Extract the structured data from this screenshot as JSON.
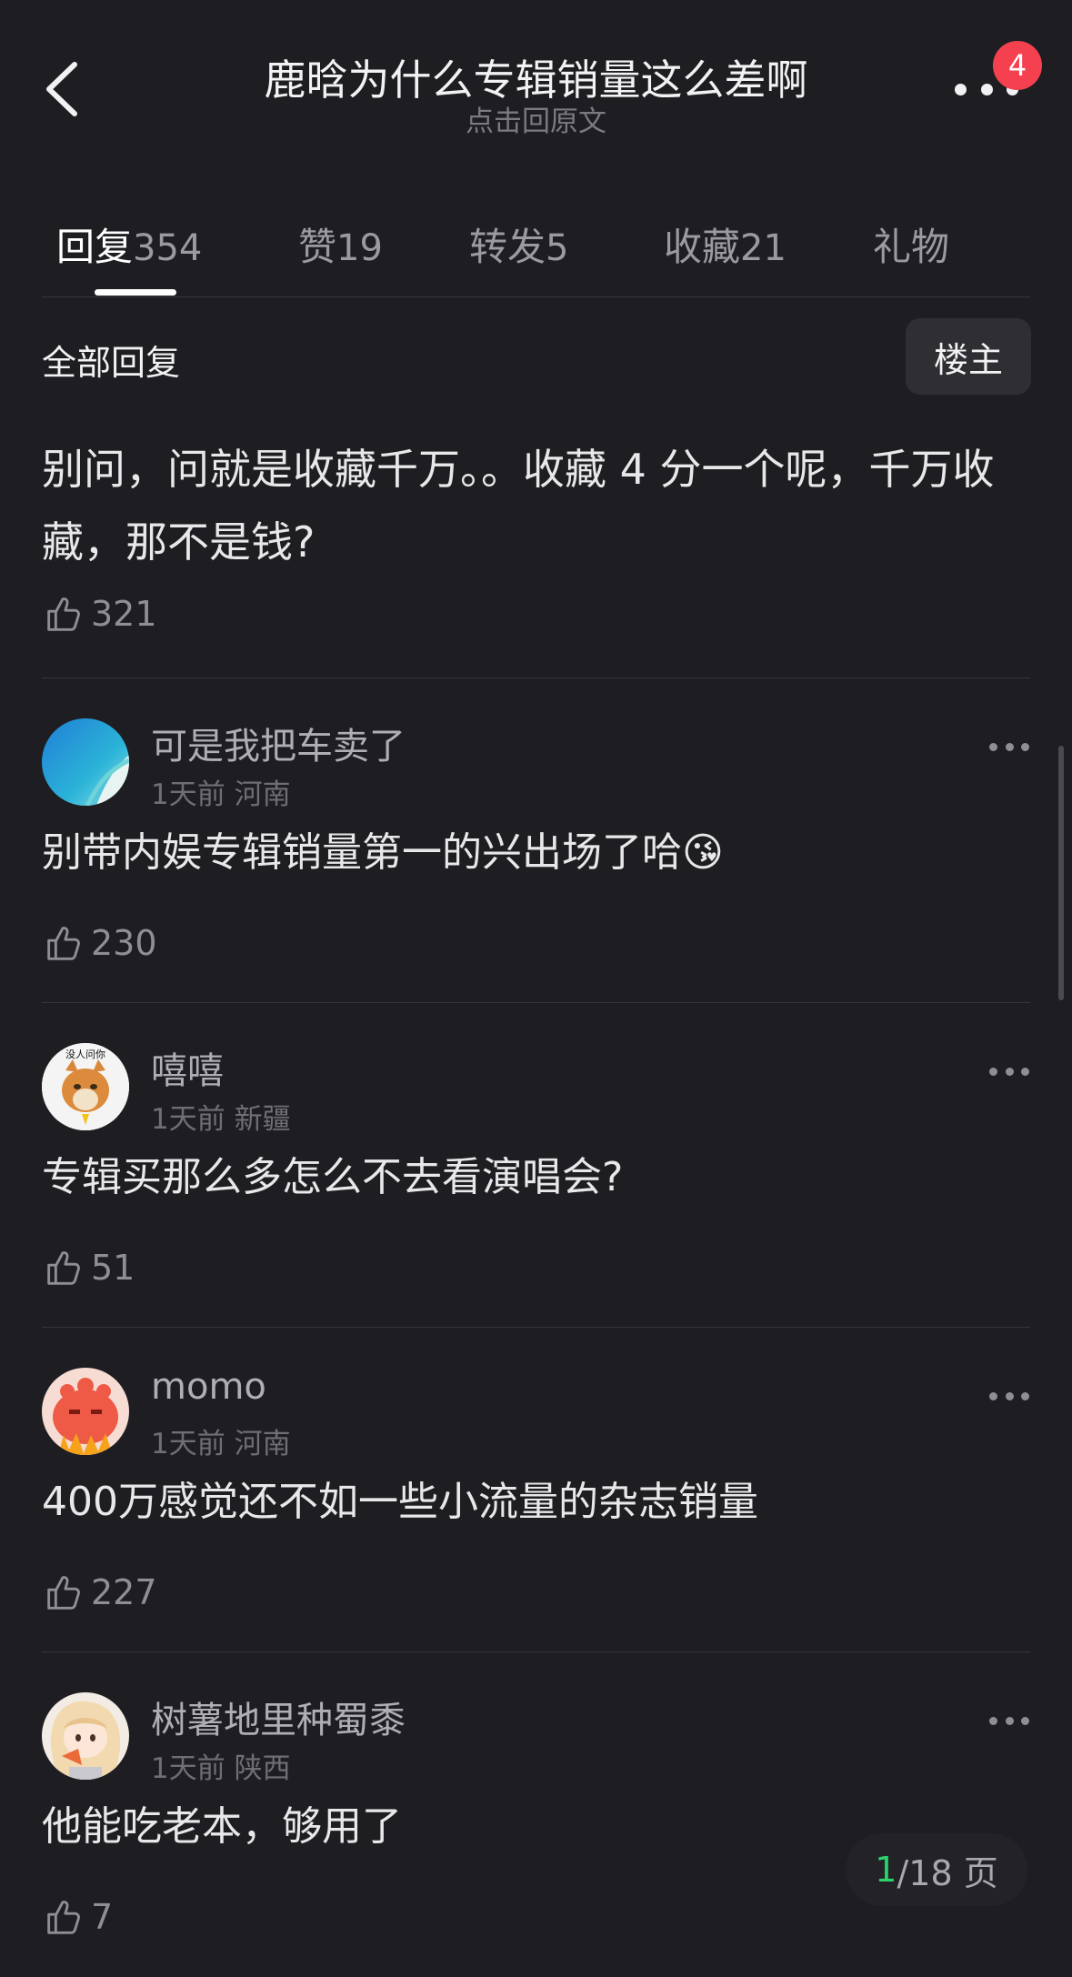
{
  "header": {
    "title": "鹿晗为什么专辑销量这么差啊",
    "subtitle": "点击回原文",
    "notification_count": "4"
  },
  "tabs": [
    {
      "label": "回复",
      "count": "354",
      "active": true
    },
    {
      "label": "赞",
      "count": "19"
    },
    {
      "label": "转发",
      "count": "5"
    },
    {
      "label": "收藏",
      "count": "21"
    },
    {
      "label": "礼物",
      "count": ""
    }
  ],
  "filter": {
    "label": "全部回复",
    "op_button": "楼主"
  },
  "op_post": {
    "text": "别问，问就是收藏千万。。收藏 4 分一个呢，千万收藏，那不是钱?",
    "likes": "321"
  },
  "comments": [
    {
      "username": "可是我把车卖了",
      "time": "1天前",
      "location": "河南",
      "text": "别带内娱专辑销量第一的兴出场了哈",
      "emoji": "😘",
      "likes": "230"
    },
    {
      "username": "嘻嘻",
      "time": "1天前",
      "location": "新疆",
      "text": "专辑买那么多怎么不去看演唱会?",
      "emoji": "",
      "likes": "51",
      "avatar_caption": "没人问你"
    },
    {
      "username": "momo",
      "time": "1天前",
      "location": "河南",
      "text": "400万感觉还不如一些小流量的杂志销量",
      "emoji": "",
      "likes": "227"
    },
    {
      "username": "树薯地里种蜀黍",
      "time": "1天前",
      "location": "陕西",
      "text": "他能吃老本，够用了",
      "emoji": "",
      "likes": "7"
    }
  ],
  "pager": {
    "current": "1",
    "total_text": "/18 页"
  },
  "colors": {
    "background": "#1e1e22",
    "badge": "#f5414f",
    "pager_current": "#2bd36a"
  }
}
